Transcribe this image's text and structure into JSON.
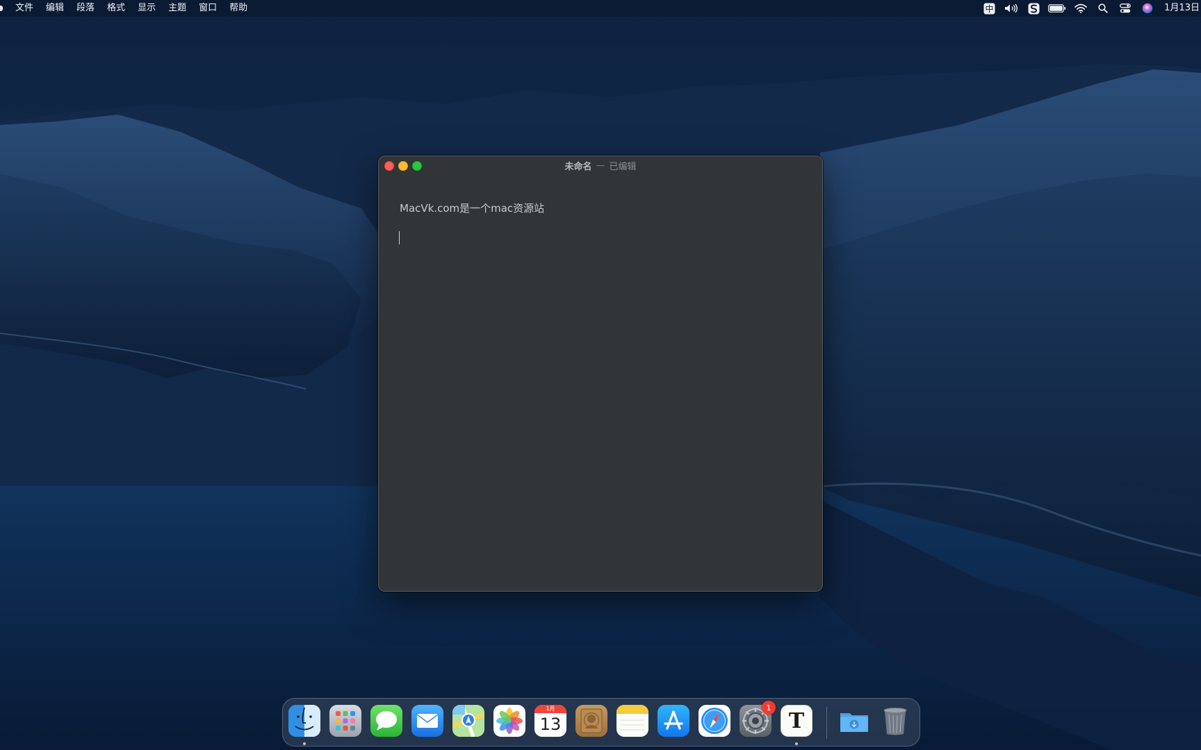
{
  "menubar": {
    "items": [
      {
        "label": "文件"
      },
      {
        "label": "编辑"
      },
      {
        "label": "段落"
      },
      {
        "label": "格式"
      },
      {
        "label": "显示"
      },
      {
        "label": "主题"
      },
      {
        "label": "窗口"
      },
      {
        "label": "帮助"
      }
    ],
    "status_icons": [
      "input-method-icon",
      "volume-icon",
      "sogou-input-icon",
      "battery-icon",
      "wifi-icon",
      "spotlight-search-icon",
      "control-center-icon",
      "siri-icon"
    ],
    "input_method_label": "中",
    "clock": "1月13日"
  },
  "window": {
    "title": "未命名",
    "separator": "—",
    "status": "已编辑",
    "content": {
      "line1": "MacVk.com是一个mac资源站"
    }
  },
  "dock": {
    "apps": [
      {
        "icon": "finder-icon",
        "running": true
      },
      {
        "icon": "launchpad-icon",
        "running": false
      },
      {
        "icon": "messages-icon",
        "running": false
      },
      {
        "icon": "mail-icon",
        "running": false
      },
      {
        "icon": "maps-icon",
        "running": false
      },
      {
        "icon": "photos-icon",
        "running": false
      },
      {
        "icon": "calendar-icon",
        "running": false,
        "month": "1月",
        "day": "13"
      },
      {
        "icon": "contacts-icon",
        "running": false
      },
      {
        "icon": "notes-icon",
        "running": false
      },
      {
        "icon": "app-store-icon",
        "running": false
      },
      {
        "icon": "safari-icon",
        "running": false
      },
      {
        "icon": "system-preferences-icon",
        "running": false,
        "badge": "1"
      },
      {
        "icon": "textedit-icon",
        "running": true,
        "glyph": "T"
      }
    ],
    "others": [
      {
        "icon": "downloads-folder-icon"
      },
      {
        "icon": "trash-icon"
      }
    ]
  },
  "colors": {
    "menubar_bg": "#0a182e",
    "window_bg": "#323538",
    "close": "#fe5f57",
    "minimize": "#febc2e",
    "maximize": "#28c840",
    "badge": "#f23c33"
  }
}
